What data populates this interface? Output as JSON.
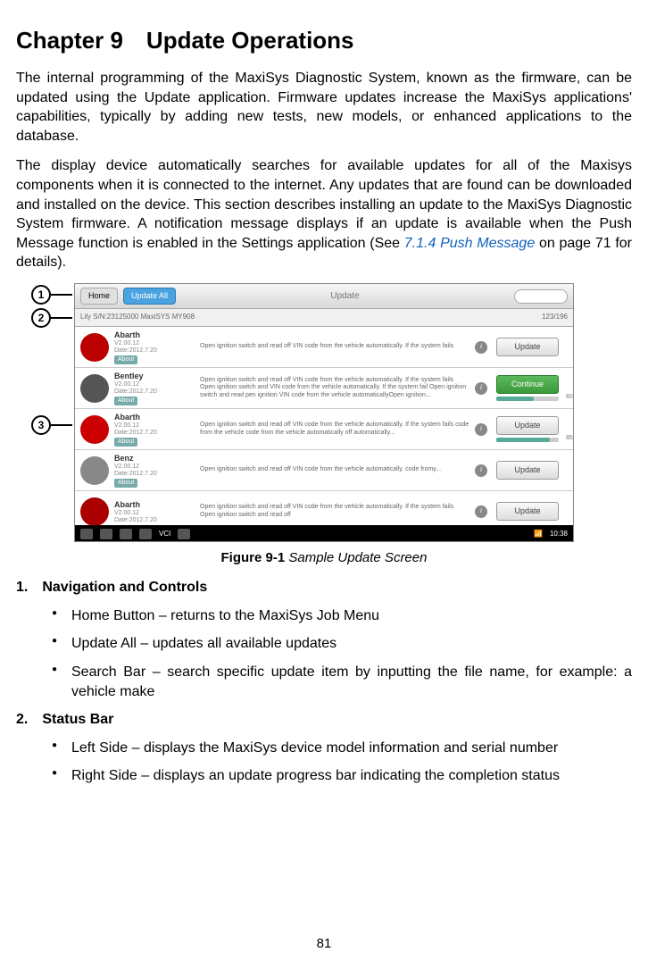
{
  "chapter_title": "Chapter 9 Update Operations",
  "para1": "The internal programming of the MaxiSys Diagnostic System, known as the firmware, can be updated using the Update application. Firmware updates increase the MaxiSys applications' capabilities, typically by adding new tests, new models, or enhanced applications to the database.",
  "para2_a": "The display device automatically searches for available updates for all of the Maxisys components when it is connected to the internet. Any updates that are found can be downloaded and installed on the device. This section describes installing an update to the MaxiSys Diagnostic System firmware. A notification message displays if an update is available when the Push Message function is enabled in the Settings application (See ",
  "para2_link": "7.1.4 Push Message",
  "para2_b": " on page 71 for details).",
  "callouts": {
    "c1": "1",
    "c2": "2",
    "c3": "3"
  },
  "figure": {
    "topbar": {
      "home": "Home",
      "update_all": "Update All",
      "title": "Update"
    },
    "infobar": {
      "left": "Lily   S/N:23125000   MaxiSYS MY908",
      "right": "123/196"
    },
    "rows": [
      {
        "logo": "ab",
        "name": "Abarth",
        "ver": "V2.00.12",
        "date": "Date:2012.7.20",
        "about": "About",
        "desc": "Open ignition switch and read off VIN code from the vehicle automatically. If the system fails",
        "btn_type": "u",
        "btn": "Update"
      },
      {
        "logo": "be",
        "name": "Bentley",
        "ver": "V2.00.12",
        "date": "Date:2012.7.20",
        "about": "About",
        "desc": "Open ignition switch and read off VIN code from the vehicle automatically. If the system fails Open ignition switch and VIN code from the vehicle automatically. If the system fail Open ignition switch and read  pen ignition VIN code from the vehicle automaticallyOpen ignition...",
        "btn_type": "c",
        "btn": "Continue",
        "pct": "60%",
        "fill": 60
      },
      {
        "logo": "bu",
        "name": "Abarth",
        "ver": "V2.00.12",
        "date": "Date:2012.7.20",
        "about": "About",
        "desc": "Open ignition switch and read off VIN code from the vehicle automatically. If the system fails  code from the  vehicle code from the vehicle automatically  off automatically...",
        "btn_type": "u",
        "btn": "Update",
        "pct": "85%",
        "fill": 85
      },
      {
        "logo": "mz",
        "name": "Benz",
        "ver": "V2.00.12",
        "date": "Date:2012.7.20",
        "about": "About",
        "desc": "Open ignition switch and read off VIN code from the vehicle automatically. code fromy...",
        "btn_type": "u",
        "btn": "Update"
      },
      {
        "logo": "fi",
        "name": "Abarth",
        "ver": "V2.00.12",
        "date": "Date:2012.7.20",
        "about": "",
        "desc": "Open ignition switch and read off VIN code from the vehicle automatically. If the system fails Open ignition switch and read off",
        "btn_type": "u",
        "btn": "Update"
      }
    ],
    "bottombar": {
      "vci": "VCI",
      "time": "10:38"
    }
  },
  "caption_b": "Figure 9-1",
  "caption_i": " Sample Update Screen",
  "section1_head": "1. Navigation and Controls",
  "section1_bullets": [
    "Home Button – returns to the MaxiSys Job Menu",
    "Update All – updates all available updates",
    "Search Bar – search specific update item by inputting the file name, for example: a vehicle make"
  ],
  "section2_head": "2. Status Bar",
  "section2_bullets": [
    "Left Side – displays the MaxiSys device model information and serial number",
    "Right Side – displays an update progress bar indicating the completion status"
  ],
  "page_number": "81"
}
